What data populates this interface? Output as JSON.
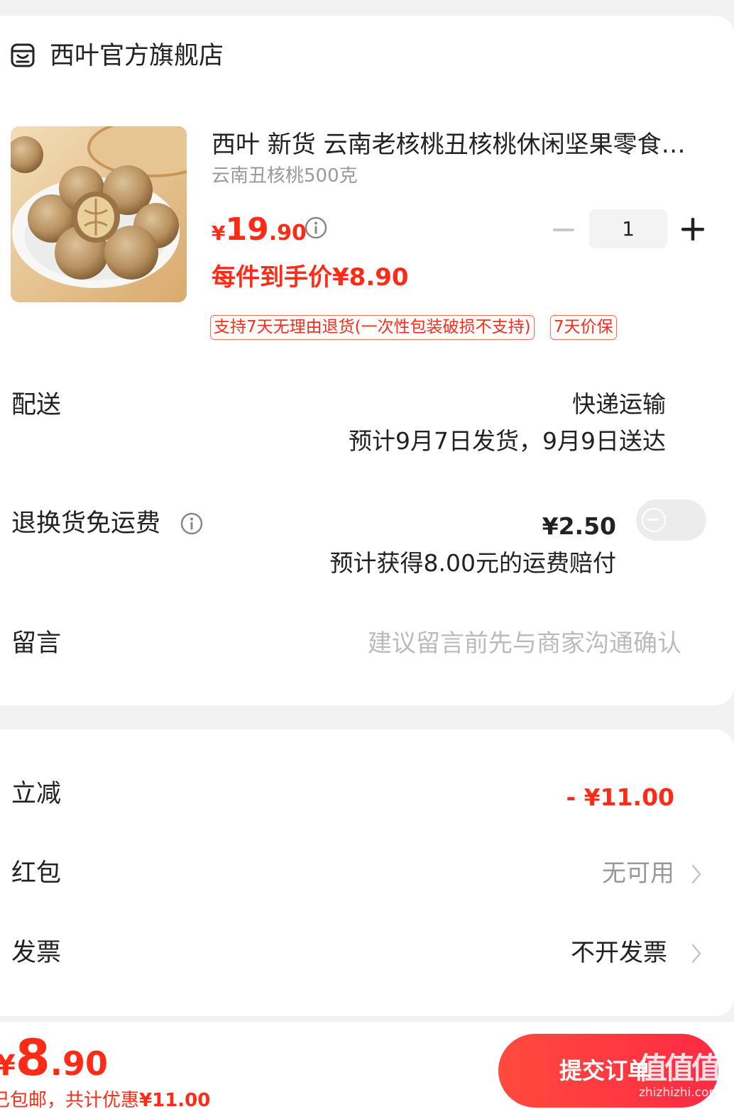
{
  "store": {
    "name": "西叶官方旗舰店",
    "icon": "store-icon"
  },
  "product": {
    "title": "西叶 新货 云南老核桃丑核桃休闲坚果零食…",
    "sku": "云南丑核桃500克",
    "price_symbol": "¥",
    "price_int": "19",
    "price_dec": ".90",
    "final_price_label": "每件到手价¥8.90",
    "quantity": "1",
    "tags": [
      "支持7天无理由退货(一次性包装破损不支持)",
      "7天价保"
    ]
  },
  "delivery": {
    "label": "配送",
    "method": "快递运输",
    "estimate": "预计9月7日发货，9月9日送达"
  },
  "return_shipping": {
    "label": "退换货免运费",
    "price": "¥2.50",
    "note": "预计获得8.00元的运费赔付",
    "enabled": false
  },
  "message": {
    "label": "留言",
    "placeholder": "建议留言前先与商家沟通确认"
  },
  "discount": {
    "label": "立减",
    "value": "- ¥11.00"
  },
  "red_packet": {
    "label": "红包",
    "value": "无可用"
  },
  "invoice": {
    "label": "发票",
    "value": "不开发票"
  },
  "footer": {
    "total_symbol": "¥",
    "total_int": "8",
    "total_dec": ".90",
    "savings_prefix": "已包邮，共计优惠",
    "savings_amount": "¥11.00",
    "submit_label": "提交订单"
  },
  "watermark": {
    "text": "值值值",
    "url": "zhizhizhi.com"
  },
  "colors": {
    "accent": "#ff2b17",
    "submit_bg": "#ff3a40"
  }
}
